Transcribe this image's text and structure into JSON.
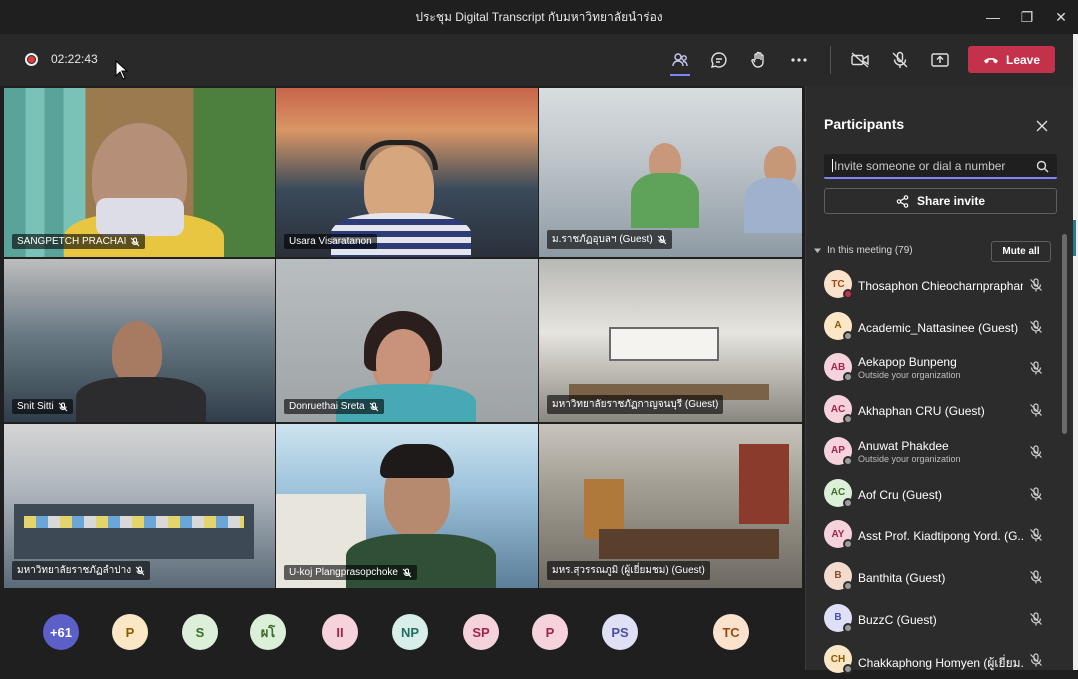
{
  "window": {
    "title": "ประชุม Digital Transcript กับมหาวิทยาลัยนำร่อง",
    "controls": [
      "minimize-icon",
      "maximize-icon",
      "close-icon"
    ]
  },
  "toolbar": {
    "timer": "02:22:43",
    "buttons": [
      "participants-icon",
      "chat-icon",
      "raise-hand-icon",
      "more-icon",
      "camera-off-icon",
      "mic-off-icon",
      "share-screen-icon"
    ],
    "leave_label": "Leave",
    "accent": "#c4314b"
  },
  "video_tiles": [
    {
      "name": "SANGPETCH PRACHAI"
    },
    {
      "name": "Usara Visaratanon"
    },
    {
      "name": "ม.ราชภัฏอุบลฯ (Guest)"
    },
    {
      "name": "Snit Sitti"
    },
    {
      "name": "Donruethai Sreta"
    },
    {
      "name": "มหาวิทยาลัยราชภัฏกาญจนบุรี (Guest)"
    },
    {
      "name": "มหาวิทยาลัยราชภัฏลำปาง"
    },
    {
      "name": "U-koj Plangprasopchoke"
    },
    {
      "name": "มหร.สุวรรณภูมิ (ผู้เยี่ยมชม) (Guest)"
    }
  ],
  "overflow_avatars": [
    {
      "initials": "+61",
      "bg": "#5b5fc7",
      "fg": "#ffffff"
    },
    {
      "initials": "P",
      "bg": "#fbe7c6",
      "fg": "#8a5a00"
    },
    {
      "initials": "S",
      "bg": "#dcefd9",
      "fg": "#3b6e2a"
    },
    {
      "initials": "ผโ",
      "bg": "#dcefd9",
      "fg": "#3b6e2a"
    },
    {
      "initials": "II",
      "bg": "#f6d2dc",
      "fg": "#a0264a"
    },
    {
      "initials": "NP",
      "bg": "#d7eee9",
      "fg": "#226e63"
    },
    {
      "initials": "SP",
      "bg": "#f6d2dc",
      "fg": "#a0264a"
    },
    {
      "initials": "P",
      "bg": "#f6d2dc",
      "fg": "#a0264a"
    },
    {
      "initials": "PS",
      "bg": "#dfe0f6",
      "fg": "#4a4fa8"
    },
    {
      "initials": "TC",
      "bg": "#fbe2cc",
      "fg": "#9a4b13"
    }
  ],
  "participants_panel": {
    "title": "Participants",
    "invite_placeholder": "Invite someone or dial a number",
    "share_invite_label": "Share invite",
    "in_meeting_label": "In this meeting (79)",
    "mute_all_label": "Mute all",
    "list": [
      {
        "initials": "TC",
        "name": "Thosaphon Chieocharnpraphan",
        "sub": "",
        "bg": "#fbe2cc",
        "fg": "#9a4b13",
        "status": "busy"
      },
      {
        "initials": "A",
        "name": "Academic_Nattasinee (Guest)",
        "sub": "",
        "bg": "#fbe7c6",
        "fg": "#8a5a00",
        "status": "offline"
      },
      {
        "initials": "AB",
        "name": "Aekapop Bunpeng",
        "sub": "Outside your organization",
        "bg": "#f6d2dc",
        "fg": "#a0264a",
        "status": "offline"
      },
      {
        "initials": "AC",
        "name": "Akhaphan CRU (Guest)",
        "sub": "",
        "bg": "#f6d2dc",
        "fg": "#a0264a",
        "status": "offline"
      },
      {
        "initials": "AP",
        "name": "Anuwat Phakdee",
        "sub": "Outside your organization",
        "bg": "#f6d2dc",
        "fg": "#a0264a",
        "status": "offline"
      },
      {
        "initials": "AC",
        "name": "Aof Cru (Guest)",
        "sub": "",
        "bg": "#dcefd9",
        "fg": "#3b6e2a",
        "status": "offline"
      },
      {
        "initials": "AY",
        "name": "Asst Prof. Kiadtipong Yord. (G...",
        "sub": "",
        "bg": "#f6d2dc",
        "fg": "#a0264a",
        "status": "offline"
      },
      {
        "initials": "B",
        "name": "Banthita (Guest)",
        "sub": "",
        "bg": "#f3dccd",
        "fg": "#8a4d2a",
        "status": "offline"
      },
      {
        "initials": "B",
        "name": "BuzzC (Guest)",
        "sub": "",
        "bg": "#dfe0f6",
        "fg": "#4a4fa8",
        "status": "offline"
      },
      {
        "initials": "CH",
        "name": "Chakkaphong Homyen (ผู้เยี่ยม...",
        "sub": "",
        "bg": "#fbe7c6",
        "fg": "#8a5a00",
        "status": "offline"
      }
    ]
  }
}
